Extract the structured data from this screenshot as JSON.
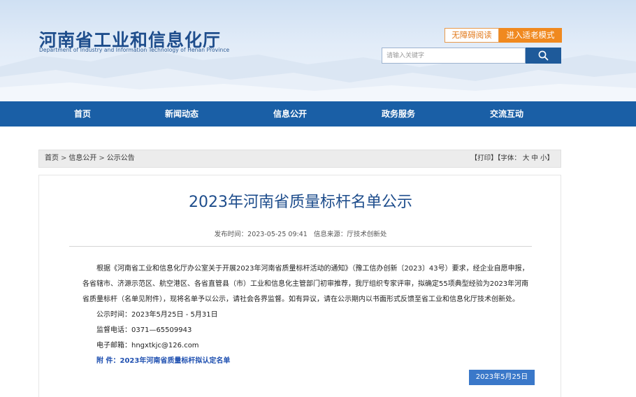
{
  "header": {
    "title": "河南省工业和信息化厅",
    "subtitle": "Department of Industry and Information Technology of Henan Province",
    "accessible_mode": "无障碍阅读",
    "elder_mode": "进入适老模式",
    "search_placeholder": "请输入关键字",
    "search_icon": "search-icon"
  },
  "nav": {
    "items": [
      "首页",
      "新闻动态",
      "信息公开",
      "政务服务",
      "交流互动"
    ]
  },
  "breadcrumb": {
    "items": [
      "首页",
      "信息公开",
      "公示公告"
    ],
    "separator": ">",
    "print": "【打印】",
    "font_label": "【字体：",
    "font_large": "大",
    "font_medium": "中",
    "font_small": "小",
    "font_close": "】"
  },
  "article": {
    "title": "2023年河南省质量标杆名单公示",
    "publish_time": "发布时间：2023-05-25 09:41",
    "source": "信息来源：厅技术创新处",
    "paragraph": "根据《河南省工业和信息化厅办公室关于开展2023年河南省质量标杆活动的通知》（豫工信办创新〔2023〕43号）要求，经企业自愿申报，各省辖市、济源示范区、航空港区、各省直管县（市）工业和信息化主管部门初审推荐，我厅组织专家评审，拟确定55项典型经验为2023年河南省质量标杆（名单见附件），现将名单予以公示，请社会各界监督。如有异议，请在公示期内以书面形式反馈至省工业和信息化厅技术创新处。",
    "notice_period": "公示时间：2023年5月25日 - 5月31日",
    "phone": "监督电话：0371—65509943",
    "email": "电子邮箱：hngxtkjc@126.com",
    "attachment_label": "附  件：",
    "attachment_link": "2023年河南省质量标杆拟认定名单",
    "date": "2023年5月25日"
  },
  "colors": {
    "brand_blue": "#1a5fa6",
    "title_blue": "#1e4d8c",
    "accent_orange": "#f0891f",
    "date_tag_blue": "#3a78c9"
  }
}
